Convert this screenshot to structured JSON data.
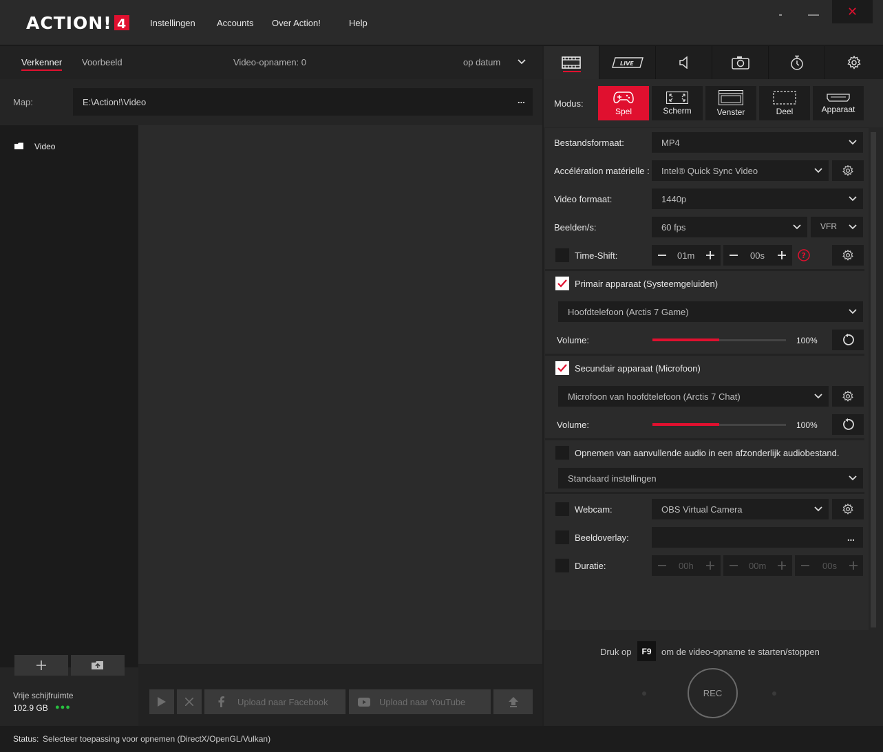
{
  "app": {
    "logo_text": "ACTION! 4"
  },
  "menu": [
    "Instellingen",
    "Accounts",
    "Over Action!",
    "Help"
  ],
  "window": {
    "minimize": "-",
    "maximize": "—",
    "close": "✕"
  },
  "left": {
    "tabs": [
      "Verkenner",
      "Voorbeeld"
    ],
    "video_count": "Video-opnamen: 0",
    "sort": "op datum",
    "map_label": "Map:",
    "map_value": "E:\\Action!\\Video",
    "map_browse": "...",
    "folders": [
      "Video"
    ],
    "free_label": "Vrije schijfruimte",
    "free_value": "102.9 GB",
    "free_dots": "●●●",
    "upload_facebook": "Upload naar Facebook",
    "upload_youtube": "Upload naar YouTube"
  },
  "status": {
    "label": "Status:",
    "text": "Selecteer toepassing voor opnemen  (DirectX/OpenGL/Vulkan)"
  },
  "right": {
    "tabs": [
      "video-tab",
      "live-tab",
      "audio-tab",
      "screenshot-tab",
      "timer-tab",
      "settings-tab"
    ],
    "live_label": "LIVE",
    "modus_label": "Modus:",
    "modes": [
      "Spel",
      "Scherm",
      "Venster",
      "Deel",
      "Apparaat"
    ],
    "bestandsformaat": {
      "label": "Bestandsformaat:",
      "value": "MP4"
    },
    "acceleration": {
      "label": "Accélération matérielle :",
      "value": "Intel® Quick Sync Video"
    },
    "videoformaat": {
      "label": "Video formaat:",
      "value": "1440p"
    },
    "beelden": {
      "label": "Beelden/s:",
      "value": "60 fps",
      "mode": "VFR"
    },
    "timeshift": {
      "label": "Time-Shift:",
      "minutes": "01m",
      "seconds": "00s"
    },
    "primair": {
      "label": "Primair apparaat (Systeemgeluiden)",
      "device": "Hoofdtelefoon (Arctis 7 Game)",
      "volume_label": "Volume:",
      "volume": "100%",
      "level": 0.5
    },
    "secundair": {
      "label": "Secundair apparaat (Microfoon)",
      "device": "Microfoon van hoofdtelefoon (Arctis 7 Chat)",
      "volume_label": "Volume:",
      "volume": "100%",
      "level": 0.5
    },
    "extra_audio": {
      "label": "Opnemen van aanvullende audio in een afzonderlijk audiobestand.",
      "value": "Standaard instellingen"
    },
    "webcam": {
      "label": "Webcam:",
      "value": "OBS Virtual Camera"
    },
    "overlay": {
      "label": "Beeldoverlay:",
      "browse": "..."
    },
    "duratie": {
      "label": "Duratie:",
      "hours": "00h",
      "minutes": "00m",
      "seconds": "00s"
    },
    "hint_before": "Druk op",
    "hint_key": "F9",
    "hint_after": "om de video-opname te starten/stoppen",
    "rec": "REC"
  },
  "colors": {
    "accent": "#e0102f",
    "background": "#1f1f1f",
    "panel": "#2b2b2b",
    "free_space": "#28c040"
  }
}
